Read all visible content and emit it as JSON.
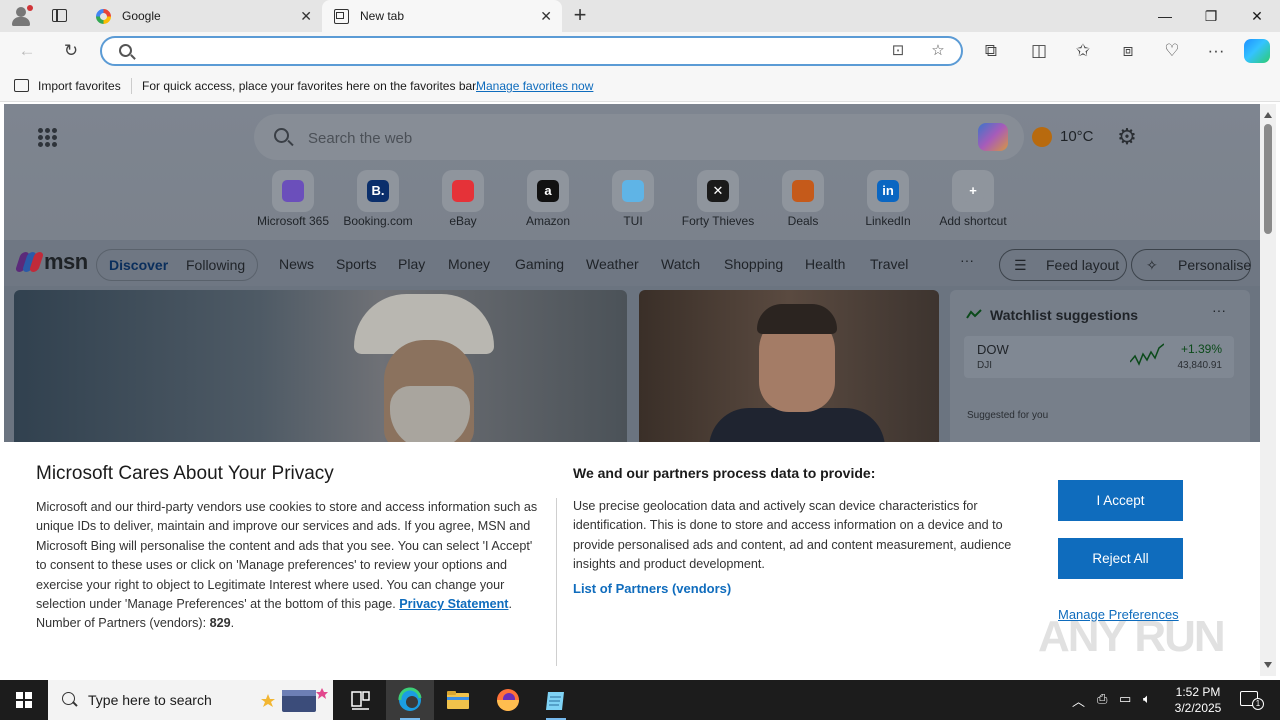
{
  "browser": {
    "tabs": [
      {
        "label": "Google",
        "active": false
      },
      {
        "label": "New tab",
        "active": true
      }
    ],
    "address": {
      "value": "",
      "placeholder": ""
    },
    "window_controls": {
      "minimize": "—",
      "restore": "❐",
      "close": "✕"
    }
  },
  "favorites_bar": {
    "import_label": "Import favorites",
    "hint": "For quick access, place your favorites here on the favorites bar.",
    "manage_link": "Manage favorites now"
  },
  "newtab": {
    "search_placeholder": "Search the web",
    "weather_temp": "10°C",
    "shortcuts": [
      {
        "label": "Microsoft 365",
        "icon": "microsoft-365-icon",
        "color": "#6b4fbb"
      },
      {
        "label": "Booking.com",
        "icon": "booking-icon",
        "color": "#0b2f6b",
        "glyph": "B."
      },
      {
        "label": "eBay",
        "icon": "ebay-icon",
        "color": "#e53238"
      },
      {
        "label": "Amazon",
        "icon": "amazon-icon",
        "color": "#111111",
        "glyph": "a"
      },
      {
        "label": "TUI",
        "icon": "tui-icon",
        "color": "#5fb4e6"
      },
      {
        "label": "Forty Thieves",
        "icon": "forty-thieves-icon",
        "color": "#1a1a1a",
        "glyph": "✕"
      },
      {
        "label": "Deals",
        "icon": "deals-icon",
        "color": "#c55a1a"
      },
      {
        "label": "LinkedIn",
        "icon": "linkedin-icon",
        "color": "#0a66c2",
        "glyph": "in"
      },
      {
        "label": "Add shortcut",
        "icon": "add-icon",
        "color": "#8f959d",
        "glyph": "+"
      }
    ],
    "msn": {
      "logo": "msn",
      "discover": "Discover",
      "following": "Following",
      "nav": [
        "News",
        "Sports",
        "Play",
        "Money",
        "Gaming",
        "Weather",
        "Watch",
        "Shopping",
        "Health",
        "Travel"
      ],
      "more": "···",
      "feed_layout": "Feed layout",
      "personalise": "Personalise"
    },
    "watchlist": {
      "title": "Watchlist suggestions",
      "more": "···",
      "row": {
        "symbol": "DOW",
        "sub": "DJI",
        "change": "+1.39%",
        "price": "43,840.91"
      },
      "suggested": "Suggested for you"
    }
  },
  "consent": {
    "title": "Microsoft Cares About Your Privacy",
    "lead": "Microsoft and our third-party vendors use cookies to store and access information such as unique IDs to deliver, maintain and improve our services and ads. If you agree, MSN and Microsoft Bing will personalise the content and ads that you see. You can select 'I Accept' to consent to these uses or click on 'Manage preferences' to review your options and exercise your right to object to Legitimate Interest where used.  You can change your selection under 'Manage Preferences' at the bottom of this page.",
    "privacy_link": "Privacy Statement",
    "partners_count_label": "Number of Partners (vendors):",
    "partners_count": "829",
    "purposes_title": "We and our partners process data to provide:",
    "purposes_text": "Use precise geolocation data and actively scan device characteristics for identification. This is done to store and access information on a device and to provide personalised ads and content, ad and content measurement, audience insights and product development.",
    "partners_link": "List of Partners (vendors)",
    "accept": "I Accept",
    "reject": "Reject All",
    "manage": "Manage Preferences",
    "watermark": "ANY RUN"
  },
  "taskbar": {
    "search_placeholder": "Type here to search",
    "time": "1:52 PM",
    "date": "3/2/2025",
    "notification_count": "1"
  }
}
